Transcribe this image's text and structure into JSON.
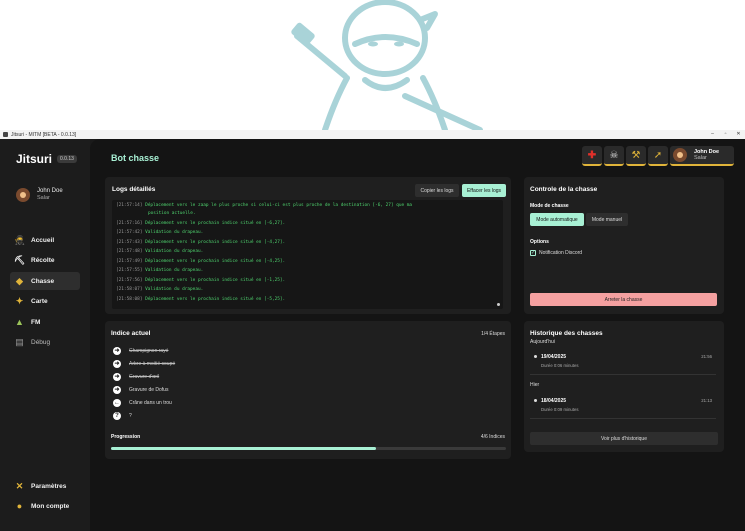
{
  "window": {
    "title": "Jitsuri - MITM [BETA - 0.0.13]",
    "controls": [
      "–",
      "▫",
      "✕"
    ]
  },
  "sidebar": {
    "brand": "Jitsuri",
    "version": "0.0.13",
    "user": {
      "name": "John Doe",
      "server": "Salar"
    },
    "items": [
      {
        "label": "Accueil",
        "icon": "ninja-icon"
      },
      {
        "label": "Récolte",
        "icon": "pickaxe-icon"
      },
      {
        "label": "Chasse",
        "icon": "chest-icon",
        "active": true
      },
      {
        "label": "Carte",
        "icon": "compass-icon"
      },
      {
        "label": "FM",
        "icon": "forge-icon"
      },
      {
        "label": "Débug",
        "icon": "bug-icon"
      }
    ],
    "bottom_items": [
      {
        "label": "Paramètres",
        "icon": "tools-icon"
      },
      {
        "label": "Mon compte",
        "icon": "account-icon"
      }
    ]
  },
  "header": {
    "title": "Bot chasse",
    "quick_actions": [
      "health-icon",
      "mask-icon",
      "axe-icon",
      "spear-icon"
    ],
    "user": {
      "name": "John Doe",
      "server": "Salar"
    }
  },
  "logs": {
    "title": "Logs détaillés",
    "copy_label": "Copier les logs",
    "clear_label": "Effacer les logs",
    "lines": [
      {
        "ts": "[21:57:14]",
        "msg": "Déplacement vers le zaap le plus proche si celui-ci est plus proche de la destination [-6, 27] que ma"
      },
      {
        "ts": "",
        "msg": "position actuelle."
      },
      {
        "ts": "[21:57:16]",
        "msg": "Déplacement vers le prochain indice situé en [-6,27]."
      },
      {
        "ts": "[21:57:42]",
        "msg": "Validation du drapeau."
      },
      {
        "ts": "[21:57:43]",
        "msg": "Déplacement vers le prochain indice situé en [-4,27]."
      },
      {
        "ts": "[21:57:48]",
        "msg": "Validation du drapeau."
      },
      {
        "ts": "[21:57:49]",
        "msg": "Déplacement vers le prochain indice situé en [-4,25]."
      },
      {
        "ts": "[21:57:55]",
        "msg": "Validation du drapeau."
      },
      {
        "ts": "[21:57:56]",
        "msg": "Déplacement vers le prochain indice situé en [-1,25]."
      },
      {
        "ts": "[21:58:07]",
        "msg": "Validation du drapeau."
      },
      {
        "ts": "[21:58:08]",
        "msg": "Déplacement vers le prochain indice situé en [-5,25]."
      }
    ]
  },
  "control": {
    "title": "Controle de la chasse",
    "mode_label": "Mode de chasse",
    "mode_auto": "Mode automatique",
    "mode_manual": "Mode manuel",
    "options_label": "Options",
    "discord_label": "Notification Discord",
    "discord_checked": true,
    "stop_label": "Arreter la chasse"
  },
  "hint": {
    "title": "Indice actuel",
    "steps_count": "1/4 Étapes",
    "steps": [
      {
        "label": "Champignon rayé",
        "done": true,
        "icon": "arrow-right-icon"
      },
      {
        "label": "Arbre à moitié coupé",
        "done": true,
        "icon": "arrow-right-icon"
      },
      {
        "label": "Gravure d'œil",
        "done": true,
        "icon": "arrow-right-icon"
      },
      {
        "label": "Gravure de Dofus",
        "done": false,
        "icon": "arrow-right-icon"
      },
      {
        "label": "Crâne dans un trou",
        "done": false,
        "icon": "arrow-left-icon"
      },
      {
        "label": "?",
        "done": false,
        "icon": "question-icon"
      }
    ],
    "progress_label": "Progression",
    "progress_count": "4/6 Indices",
    "progress_fraction": 0.67
  },
  "history": {
    "title": "Historique des chasses",
    "groups": [
      {
        "label": "Aujourd'hui",
        "entries": [
          {
            "date": "19/04/2025",
            "duration": "Durée 0:06 minutes",
            "time": "21:56"
          }
        ]
      },
      {
        "label": "Hier",
        "entries": [
          {
            "date": "18/04/2025",
            "duration": "Durée 0:09 minutes",
            "time": "21:13"
          }
        ]
      }
    ],
    "more_label": "Voir plus d'historique"
  },
  "colors": {
    "accent": "#a8f0d4",
    "danger": "#f4a0a0",
    "gold": "#e0b43a",
    "log_green": "#4fd46f"
  }
}
